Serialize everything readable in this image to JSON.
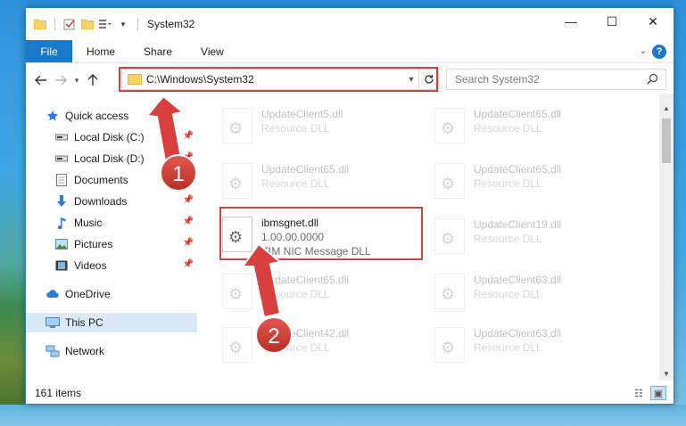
{
  "window": {
    "title": "System32",
    "controls": {
      "minimize": "—",
      "maximize": "☐",
      "close": "✕"
    }
  },
  "ribbon": {
    "file": "File",
    "tabs": [
      "Home",
      "Share",
      "View"
    ],
    "help": "?"
  },
  "address": {
    "path": "C:\\Windows\\System32",
    "search_placeholder": "Search System32"
  },
  "nav": {
    "items": [
      {
        "label": "Quick access",
        "icon": "star-icon"
      },
      {
        "label": "Local Disk (C:)",
        "icon": "drive-icon",
        "pinned": true
      },
      {
        "label": "Local Disk (D:)",
        "icon": "drive-icon",
        "pinned": true
      },
      {
        "label": "Documents",
        "icon": "documents-icon",
        "pinned": true
      },
      {
        "label": "Downloads",
        "icon": "download-arrow-icon",
        "pinned": true
      },
      {
        "label": "Music",
        "icon": "music-note-icon",
        "pinned": true
      },
      {
        "label": "Pictures",
        "icon": "pictures-icon",
        "pinned": true
      },
      {
        "label": "Videos",
        "icon": "film-icon",
        "pinned": true
      },
      {
        "label": "OneDrive",
        "icon": "cloud-icon"
      },
      {
        "label": "This PC",
        "icon": "monitor-icon",
        "selected": true
      },
      {
        "label": "Network",
        "icon": "network-icon"
      }
    ]
  },
  "files": [
    {
      "name": "UpdateClient5.dll",
      "desc": "Resource DLL",
      "faded": true
    },
    {
      "name": "UpdateClient65.dll",
      "desc": "Resource DLL",
      "faded": true
    },
    {
      "name": "UpdateClient65.dll",
      "desc": "Resource DLL",
      "faded": true
    },
    {
      "name": "UpdateClient65.dll",
      "desc": "Resource DLL",
      "faded": true
    },
    {
      "name": "ibmsgnet.dll",
      "version": "1.00.00.0000",
      "desc": "IBM NIC Message DLL",
      "faded": false
    },
    {
      "name": "UpdateClient19.dll",
      "desc": "Resource DLL",
      "faded": true
    },
    {
      "name": "UpdateClient65.dll",
      "desc": "Resource DLL",
      "faded": true
    },
    {
      "name": "UpdateClient63.dll",
      "desc": "Resource DLL",
      "faded": true
    },
    {
      "name": "UpdateClient42.dll",
      "desc": "Resource DLL",
      "faded": true
    },
    {
      "name": "UpdateClient63.dll",
      "desc": "Resource DLL",
      "faded": true
    }
  ],
  "status": {
    "count": "161 items"
  },
  "annotations": {
    "step1": "1",
    "step2": "2",
    "color": "#d9403d"
  }
}
